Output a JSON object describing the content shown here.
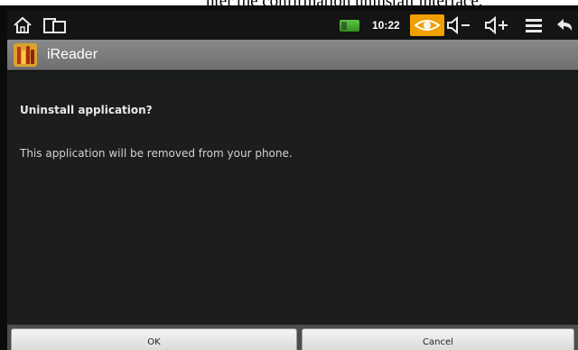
{
  "caption": {
    "text": "nter the confirmation uninstall interface."
  },
  "status_bar": {
    "time": "10:22",
    "icons": [
      "home-icon",
      "dual-pane-icon",
      "battery-icon",
      "eye-icon",
      "volume-down-icon",
      "volume-up-icon",
      "menu-icon",
      "back-icon"
    ],
    "accent_color": "#f0a000",
    "battery_color": "#4cb832"
  },
  "title_bar": {
    "app_name": "iReader",
    "app_icon": "bookshelf-icon"
  },
  "dialog": {
    "heading": "Uninstall application?",
    "message": "This application will be removed from your phone."
  },
  "buttons": {
    "ok_label": "OK",
    "cancel_label": "Cancel"
  }
}
